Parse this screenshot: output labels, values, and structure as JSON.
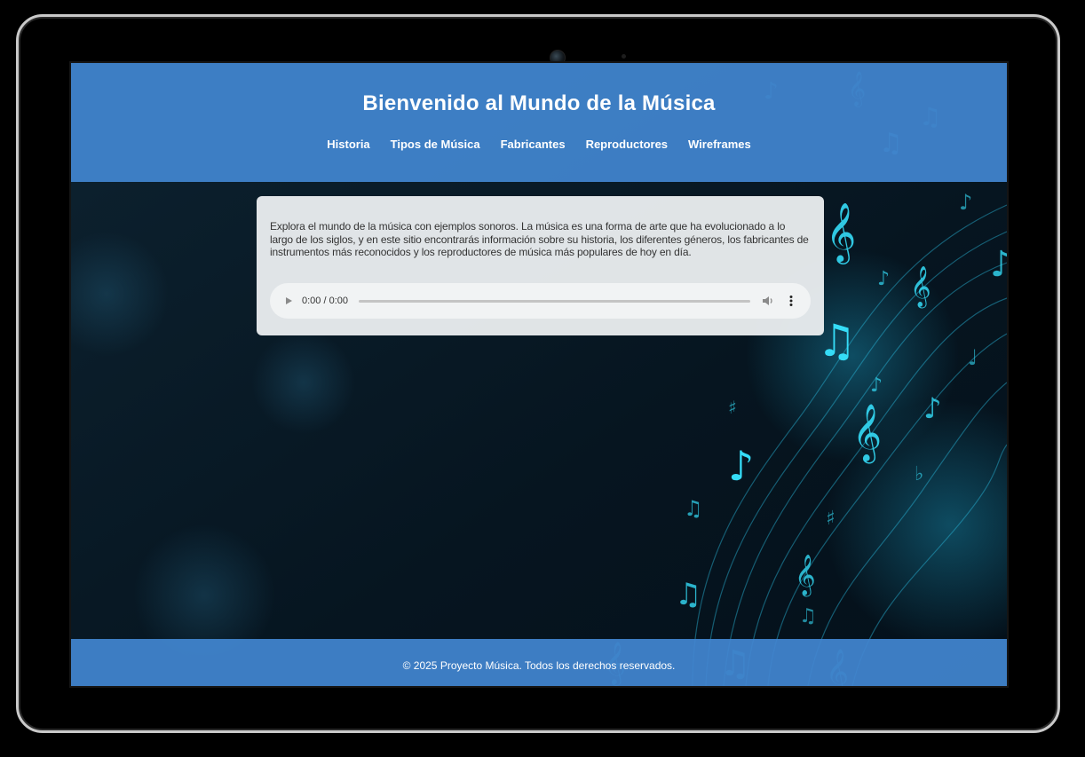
{
  "header": {
    "title": "Bienvenido al Mundo de la Música",
    "nav": [
      {
        "label": "Historia"
      },
      {
        "label": "Tipos de Música"
      },
      {
        "label": "Fabricantes"
      },
      {
        "label": "Reproductores"
      },
      {
        "label": "Wireframes"
      }
    ]
  },
  "main": {
    "intro": "Explora el mundo de la música con ejemplos sonoros. La música es una forma de arte que ha evolucionado a lo largo de los siglos, y en este sitio encontrarás información sobre su historia, los diferentes géneros, los fabricantes de instrumentos más reconocidos y los reproductores de música más populares de hoy en día.",
    "audio_player": {
      "time": "0:00 / 0:00",
      "progress": 0
    }
  },
  "footer": {
    "copyright": "© 2025 Proyecto Música. Todos los derechos reservados."
  },
  "colors": {
    "header_bg": "#4285d0",
    "background": "#0b1a24",
    "accent_glow": "#29d3f5",
    "card_bg": "#eceff1"
  },
  "icons": [
    "play-icon",
    "volume-icon",
    "more-vert-icon"
  ]
}
